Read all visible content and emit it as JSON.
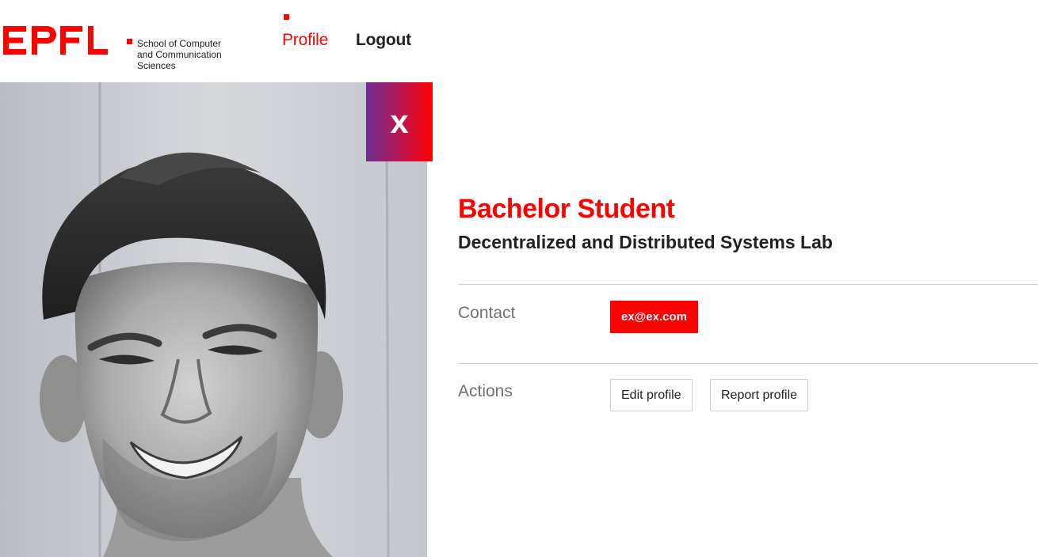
{
  "brand": {
    "logo_text": "EPFL",
    "school": "School of Computer\nand Communication\nSciences",
    "accent_color": "#ff0000"
  },
  "nav": {
    "profile": "Profile",
    "logout": "Logout",
    "active": "profile"
  },
  "photo": {
    "close_label": "x"
  },
  "profile": {
    "role": "Bachelor Student",
    "lab": "Decentralized and Distributed Systems Lab",
    "contact_label": "Contact",
    "email": "ex@ex.com",
    "actions_label": "Actions",
    "edit_label": "Edit profile",
    "report_label": "Report profile"
  }
}
